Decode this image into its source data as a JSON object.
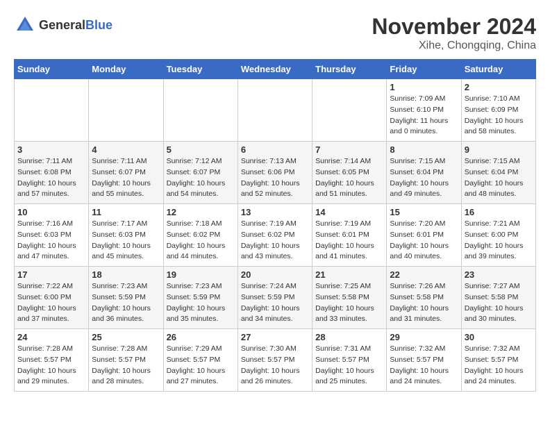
{
  "header": {
    "logo_general": "General",
    "logo_blue": "Blue",
    "title": "November 2024",
    "location": "Xihe, Chongqing, China"
  },
  "weekdays": [
    "Sunday",
    "Monday",
    "Tuesday",
    "Wednesday",
    "Thursday",
    "Friday",
    "Saturday"
  ],
  "weeks": [
    {
      "days": [
        {
          "num": "",
          "info": ""
        },
        {
          "num": "",
          "info": ""
        },
        {
          "num": "",
          "info": ""
        },
        {
          "num": "",
          "info": ""
        },
        {
          "num": "",
          "info": ""
        },
        {
          "num": "1",
          "info": "Sunrise: 7:09 AM\nSunset: 6:10 PM\nDaylight: 11 hours\nand 0 minutes."
        },
        {
          "num": "2",
          "info": "Sunrise: 7:10 AM\nSunset: 6:09 PM\nDaylight: 10 hours\nand 58 minutes."
        }
      ]
    },
    {
      "days": [
        {
          "num": "3",
          "info": "Sunrise: 7:11 AM\nSunset: 6:08 PM\nDaylight: 10 hours\nand 57 minutes."
        },
        {
          "num": "4",
          "info": "Sunrise: 7:11 AM\nSunset: 6:07 PM\nDaylight: 10 hours\nand 55 minutes."
        },
        {
          "num": "5",
          "info": "Sunrise: 7:12 AM\nSunset: 6:07 PM\nDaylight: 10 hours\nand 54 minutes."
        },
        {
          "num": "6",
          "info": "Sunrise: 7:13 AM\nSunset: 6:06 PM\nDaylight: 10 hours\nand 52 minutes."
        },
        {
          "num": "7",
          "info": "Sunrise: 7:14 AM\nSunset: 6:05 PM\nDaylight: 10 hours\nand 51 minutes."
        },
        {
          "num": "8",
          "info": "Sunrise: 7:15 AM\nSunset: 6:04 PM\nDaylight: 10 hours\nand 49 minutes."
        },
        {
          "num": "9",
          "info": "Sunrise: 7:15 AM\nSunset: 6:04 PM\nDaylight: 10 hours\nand 48 minutes."
        }
      ]
    },
    {
      "days": [
        {
          "num": "10",
          "info": "Sunrise: 7:16 AM\nSunset: 6:03 PM\nDaylight: 10 hours\nand 47 minutes."
        },
        {
          "num": "11",
          "info": "Sunrise: 7:17 AM\nSunset: 6:03 PM\nDaylight: 10 hours\nand 45 minutes."
        },
        {
          "num": "12",
          "info": "Sunrise: 7:18 AM\nSunset: 6:02 PM\nDaylight: 10 hours\nand 44 minutes."
        },
        {
          "num": "13",
          "info": "Sunrise: 7:19 AM\nSunset: 6:02 PM\nDaylight: 10 hours\nand 43 minutes."
        },
        {
          "num": "14",
          "info": "Sunrise: 7:19 AM\nSunset: 6:01 PM\nDaylight: 10 hours\nand 41 minutes."
        },
        {
          "num": "15",
          "info": "Sunrise: 7:20 AM\nSunset: 6:01 PM\nDaylight: 10 hours\nand 40 minutes."
        },
        {
          "num": "16",
          "info": "Sunrise: 7:21 AM\nSunset: 6:00 PM\nDaylight: 10 hours\nand 39 minutes."
        }
      ]
    },
    {
      "days": [
        {
          "num": "17",
          "info": "Sunrise: 7:22 AM\nSunset: 6:00 PM\nDaylight: 10 hours\nand 37 minutes."
        },
        {
          "num": "18",
          "info": "Sunrise: 7:23 AM\nSunset: 5:59 PM\nDaylight: 10 hours\nand 36 minutes."
        },
        {
          "num": "19",
          "info": "Sunrise: 7:23 AM\nSunset: 5:59 PM\nDaylight: 10 hours\nand 35 minutes."
        },
        {
          "num": "20",
          "info": "Sunrise: 7:24 AM\nSunset: 5:59 PM\nDaylight: 10 hours\nand 34 minutes."
        },
        {
          "num": "21",
          "info": "Sunrise: 7:25 AM\nSunset: 5:58 PM\nDaylight: 10 hours\nand 33 minutes."
        },
        {
          "num": "22",
          "info": "Sunrise: 7:26 AM\nSunset: 5:58 PM\nDaylight: 10 hours\nand 31 minutes."
        },
        {
          "num": "23",
          "info": "Sunrise: 7:27 AM\nSunset: 5:58 PM\nDaylight: 10 hours\nand 30 minutes."
        }
      ]
    },
    {
      "days": [
        {
          "num": "24",
          "info": "Sunrise: 7:28 AM\nSunset: 5:57 PM\nDaylight: 10 hours\nand 29 minutes."
        },
        {
          "num": "25",
          "info": "Sunrise: 7:28 AM\nSunset: 5:57 PM\nDaylight: 10 hours\nand 28 minutes."
        },
        {
          "num": "26",
          "info": "Sunrise: 7:29 AM\nSunset: 5:57 PM\nDaylight: 10 hours\nand 27 minutes."
        },
        {
          "num": "27",
          "info": "Sunrise: 7:30 AM\nSunset: 5:57 PM\nDaylight: 10 hours\nand 26 minutes."
        },
        {
          "num": "28",
          "info": "Sunrise: 7:31 AM\nSunset: 5:57 PM\nDaylight: 10 hours\nand 25 minutes."
        },
        {
          "num": "29",
          "info": "Sunrise: 7:32 AM\nSunset: 5:57 PM\nDaylight: 10 hours\nand 24 minutes."
        },
        {
          "num": "30",
          "info": "Sunrise: 7:32 AM\nSunset: 5:57 PM\nDaylight: 10 hours\nand 24 minutes."
        }
      ]
    }
  ]
}
